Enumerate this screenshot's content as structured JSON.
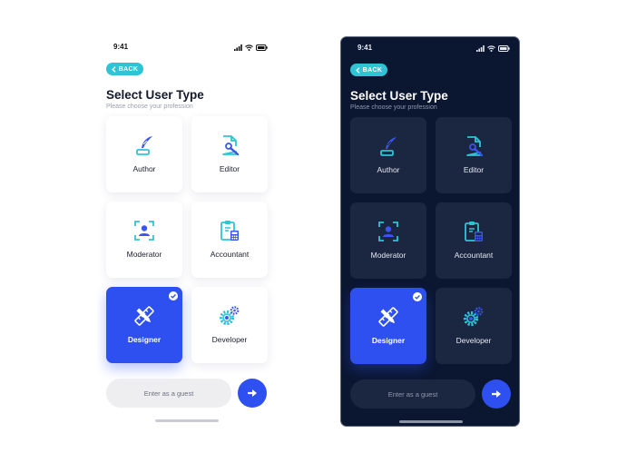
{
  "status": {
    "time": "9:41"
  },
  "back_label": "BACK",
  "title": "Select User Type",
  "subtitle": "Please choose your profession",
  "user_types": [
    {
      "label": "Author",
      "icon": "quill-icon"
    },
    {
      "label": "Editor",
      "icon": "document-edit-icon"
    },
    {
      "label": "Moderator",
      "icon": "user-focus-icon"
    },
    {
      "label": "Accountant",
      "icon": "clipboard-calculator-icon"
    },
    {
      "label": "Designer",
      "icon": "pencil-ruler-icon",
      "selected": true
    },
    {
      "label": "Developer",
      "icon": "gears-icon"
    }
  ],
  "guest_label": "Enter as a guest",
  "colors": {
    "accent": "#2f50f0",
    "back_button": "#2ec4d6",
    "icon_teal": "#2ec4d6",
    "icon_blue": "#3a55f0",
    "dark_background": "#0b1631",
    "dark_card": "#1b2640"
  }
}
